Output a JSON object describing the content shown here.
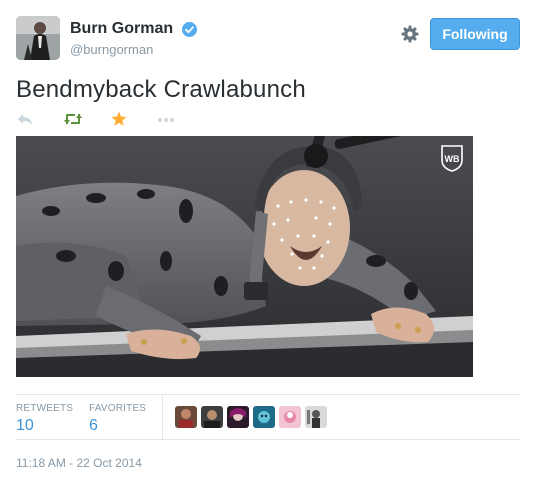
{
  "user": {
    "fullname": "Burn Gorman",
    "username": "@burngorman",
    "verified": true,
    "avatar_icon": "user-avatar"
  },
  "header": {
    "follow_label": "Following",
    "settings_icon": "gear-icon",
    "accent_color": "#55acee"
  },
  "tweet": {
    "text": "Bendmyback Crawlabunch",
    "media_watermark": "WB",
    "actions": [
      {
        "name": "reply",
        "icon": "reply-icon"
      },
      {
        "name": "retweet",
        "icon": "retweet-icon",
        "color": "#5c913b"
      },
      {
        "name": "favorite",
        "icon": "star-icon",
        "color": "#ffac33"
      },
      {
        "name": "more",
        "icon": "more-icon"
      }
    ]
  },
  "stats": {
    "retweets_label": "RETWEETS",
    "retweets_value": "10",
    "favorites_label": "FAVORITES",
    "favorites_value": "6",
    "favorited_by_count": 6
  },
  "timestamp": "11:18 AM - 22 Oct 2014"
}
